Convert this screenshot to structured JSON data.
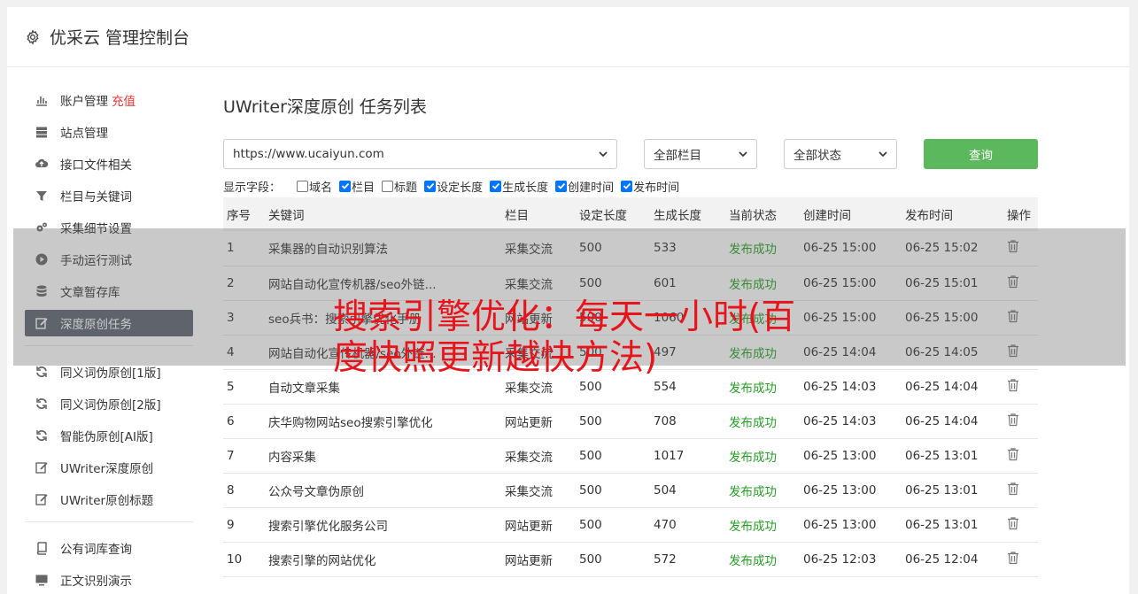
{
  "header": {
    "icon": "gear-icon",
    "title": "优采云 管理控制台"
  },
  "sidebar": {
    "items": [
      {
        "icon": "bar-chart-icon",
        "label": "账户管理",
        "extra": "充值"
      },
      {
        "icon": "server-icon",
        "label": "站点管理"
      },
      {
        "icon": "cloud-upload-icon",
        "label": "接口文件相关"
      },
      {
        "icon": "filter-icon",
        "label": "栏目与关键词"
      },
      {
        "icon": "cogs-icon",
        "label": "采集细节设置"
      },
      {
        "icon": "play-circle-icon",
        "label": "手动运行测试"
      },
      {
        "icon": "database-icon",
        "label": "文章暂存库"
      },
      {
        "icon": "edit-icon",
        "label": "深度原创任务",
        "active": true
      },
      {
        "icon": "refresh-icon",
        "label": "同义词伪原创[1版]"
      },
      {
        "icon": "refresh-icon",
        "label": "同义词伪原创[2版]"
      },
      {
        "icon": "refresh-icon",
        "label": "智能伪原创[AI版]"
      },
      {
        "icon": "edit-icon",
        "label": "UWriter深度原创"
      },
      {
        "icon": "edit-icon",
        "label": "UWriter原创标题"
      },
      {
        "icon": "book-icon",
        "label": "公有词库查询"
      },
      {
        "icon": "monitor-icon",
        "label": "正文识别演示"
      }
    ]
  },
  "main": {
    "title": "UWriter深度原创 任务列表",
    "filters": {
      "url": "https://www.ucaiyun.com",
      "column": "全部栏目",
      "status": "全部状态",
      "query_label": "查询"
    },
    "fields_label": "显示字段：",
    "fields": [
      {
        "label": "域名",
        "checked": false
      },
      {
        "label": "栏目",
        "checked": true
      },
      {
        "label": "标题",
        "checked": false
      },
      {
        "label": "设定长度",
        "checked": true
      },
      {
        "label": "生成长度",
        "checked": true
      },
      {
        "label": "创建时间",
        "checked": true
      },
      {
        "label": "发布时间",
        "checked": true
      }
    ],
    "table": {
      "headers": [
        "序号",
        "关键词",
        "栏目",
        "设定长度",
        "生成长度",
        "当前状态",
        "创建时间",
        "发布时间",
        "操作"
      ],
      "rows": [
        [
          "1",
          "采集器的自动识别算法",
          "采集交流",
          "500",
          "533",
          "发布成功",
          "06-25 15:00",
          "06-25 15:02"
        ],
        [
          "2",
          "网站自动化宣传机器/seo外链...",
          "采集交流",
          "500",
          "601",
          "发布成功",
          "06-25 15:00",
          "06-25 15:01"
        ],
        [
          "3",
          "seo兵书：搜索引擎优化手册",
          "网站更新",
          "500",
          "1060",
          "发布成功",
          "06-25 15:00",
          "06-25 15:00"
        ],
        [
          "4",
          "网站自动化宣传机器/seo外链...",
          "采集交流",
          "500",
          "497",
          "发布成功",
          "06-25 14:04",
          "06-25 14:05"
        ],
        [
          "5",
          "自动文章采集",
          "采集交流",
          "500",
          "554",
          "发布成功",
          "06-25 14:03",
          "06-25 14:04"
        ],
        [
          "6",
          "庆华购物网站seo搜索引擎优化",
          "网站更新",
          "500",
          "708",
          "发布成功",
          "06-25 14:03",
          "06-25 14:04"
        ],
        [
          "7",
          "内容采集",
          "采集交流",
          "500",
          "1017",
          "发布成功",
          "06-25 13:00",
          "06-25 13:01"
        ],
        [
          "8",
          "公众号文章伪原创",
          "采集交流",
          "500",
          "504",
          "发布成功",
          "06-25 13:00",
          "06-25 13:01"
        ],
        [
          "9",
          "搜索引擎优化服务公司",
          "网站更新",
          "500",
          "470",
          "发布成功",
          "06-25 13:00",
          "06-25 13:01"
        ],
        [
          "10",
          "搜索引擎的网站优化",
          "网站更新",
          "500",
          "572",
          "发布成功",
          "06-25 12:03",
          "06-25 12:04"
        ]
      ]
    }
  },
  "overlay": {
    "text": "搜索引擎优化：每天一小时(百度快照更新越快方法)"
  }
}
